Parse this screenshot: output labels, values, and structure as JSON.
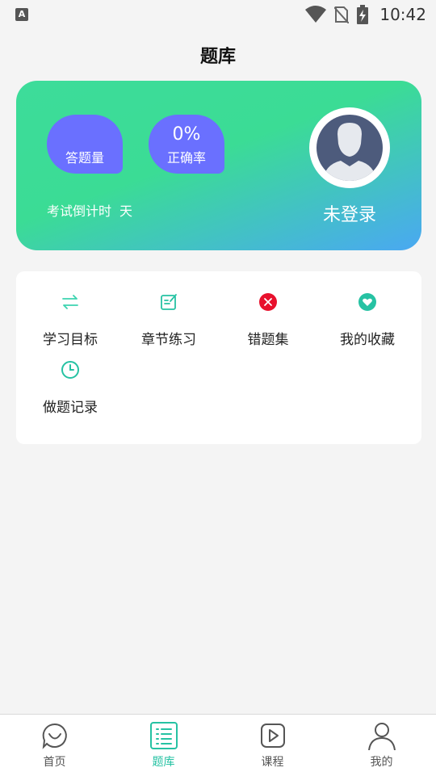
{
  "status_bar": {
    "time": "10:42",
    "left_icon": "A"
  },
  "header": {
    "title": "题库"
  },
  "stats": {
    "answered_label": "答题量",
    "answered_value": "",
    "accuracy_label": "正确率",
    "accuracy_value": "0%",
    "countdown_label": "考试倒计时",
    "countdown_unit": "天",
    "login_status": "未登录",
    "gradient_start": "#3ddc9a",
    "gradient_end": "#4aa8f2",
    "bubble_color": "#6a70ff"
  },
  "menu": {
    "items": [
      {
        "label": "学习目标",
        "icon": "swap-arrows-icon"
      },
      {
        "label": "章节练习",
        "icon": "edit-note-icon"
      },
      {
        "label": "错题集",
        "icon": "wrong-x-icon"
      },
      {
        "label": "我的收藏",
        "icon": "heart-icon"
      },
      {
        "label": "做题记录",
        "icon": "clock-icon"
      }
    ]
  },
  "bottom_nav": {
    "items": [
      {
        "label": "首页",
        "icon": "home-smile-icon"
      },
      {
        "label": "题库",
        "icon": "list-icon",
        "active": true
      },
      {
        "label": "课程",
        "icon": "play-icon"
      },
      {
        "label": "我的",
        "icon": "person-icon"
      }
    ],
    "accent": "#26c2a3"
  }
}
